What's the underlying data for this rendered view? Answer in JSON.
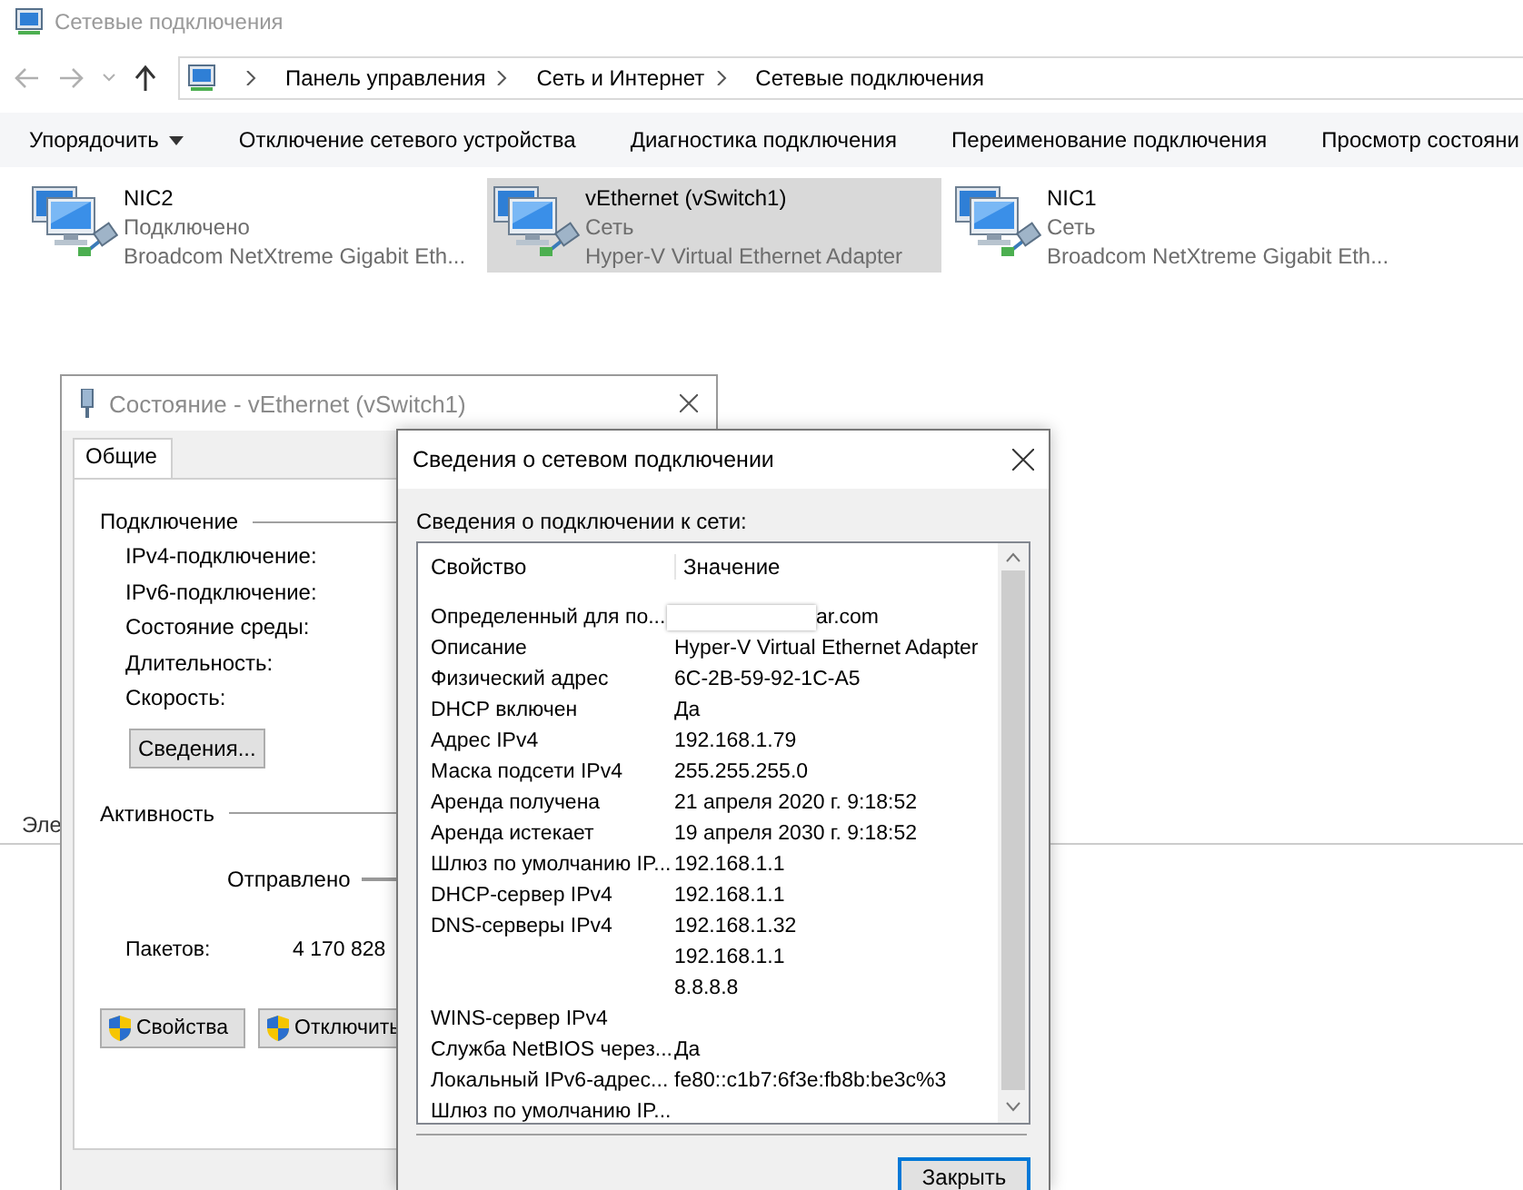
{
  "window": {
    "title": "Сетевые подключения"
  },
  "address_bar": {
    "breadcrumbs": [
      "Панель управления",
      "Сеть и Интернет",
      "Сетевые подключения"
    ]
  },
  "toolbar": [
    {
      "label": "Упорядочить",
      "kind": "dropdown"
    },
    {
      "label": "Отключение сетевого устройства",
      "kind": "command"
    },
    {
      "label": "Диагностика подключения",
      "kind": "command"
    },
    {
      "label": "Переименование подключения",
      "kind": "command"
    },
    {
      "label": "Просмотр состояни",
      "kind": "command"
    }
  ],
  "connections": [
    {
      "name": "NIC2",
      "status": "Подключено",
      "device": "Broadcom NetXtreme Gigabit Eth...",
      "selected": false
    },
    {
      "name": "vEthernet (vSwitch1)",
      "status": "Сеть",
      "device": "Hyper-V Virtual Ethernet Adapter",
      "selected": true
    },
    {
      "name": "NIC1",
      "status": "Сеть",
      "device": "Broadcom NetXtreme Gigabit Eth...",
      "selected": false
    }
  ],
  "status_bar": {
    "text": "Эле"
  },
  "status_dialog": {
    "title": "Состояние - vEthernet (vSwitch1)",
    "tabs": [
      {
        "label": "Общие",
        "selected": true
      }
    ],
    "connection_group": "Подключение",
    "connection_fields": [
      "IPv4-подключение:",
      "IPv6-подключение:",
      "Состояние среды:",
      "Длительность:",
      "Скорость:"
    ],
    "details_button": "Сведения...",
    "activity_group": "Активность",
    "sent_label": "Отправлено",
    "packets_label": "Пакетов:",
    "packets_sent": "4 170 828",
    "buttons": [
      "Свойства",
      "Отключить"
    ]
  },
  "details_dialog": {
    "title": "Сведения о сетевом подключении",
    "caption": "Сведения о подключении к сети:",
    "columns": [
      "Свойство",
      "Значение"
    ],
    "rows": [
      {
        "property": "Определенный для по...",
        "value": "ar.com",
        "redacted": true
      },
      {
        "property": "Описание",
        "value": "Hyper-V Virtual Ethernet Adapter",
        "redacted": false
      },
      {
        "property": "Физический адрес",
        "value": "6C-2B-59-92-1C-A5",
        "redacted": false
      },
      {
        "property": "DHCP включен",
        "value": "Да",
        "redacted": false
      },
      {
        "property": "Адрес IPv4",
        "value": "192.168.1.79",
        "redacted": false
      },
      {
        "property": "Маска подсети IPv4",
        "value": "255.255.255.0",
        "redacted": false
      },
      {
        "property": "Аренда получена",
        "value": "21 апреля 2020 г. 9:18:52",
        "redacted": false
      },
      {
        "property": "Аренда истекает",
        "value": "19 апреля 2030 г. 9:18:52",
        "redacted": false
      },
      {
        "property": "Шлюз по умолчанию IP...",
        "value": "192.168.1.1",
        "redacted": false
      },
      {
        "property": "DHCP-сервер IPv4",
        "value": "192.168.1.1",
        "redacted": false
      },
      {
        "property": "DNS-серверы IPv4",
        "value": "192.168.1.32",
        "redacted": false
      },
      {
        "property": "",
        "value": "192.168.1.1",
        "redacted": false
      },
      {
        "property": "",
        "value": "8.8.8.8",
        "redacted": false
      },
      {
        "property": "WINS-сервер IPv4",
        "value": "",
        "redacted": false
      },
      {
        "property": "Служба NetBIOS через...",
        "value": "Да",
        "redacted": false
      },
      {
        "property": "Локальный IPv6-адрес...",
        "value": "fe80::c1b7:6f3e:fb8b:be3c%3",
        "redacted": false
      },
      {
        "property": "Шлюз по умолчанию IP...",
        "value": "",
        "redacted": false
      }
    ],
    "close_button": "Закрыть"
  }
}
